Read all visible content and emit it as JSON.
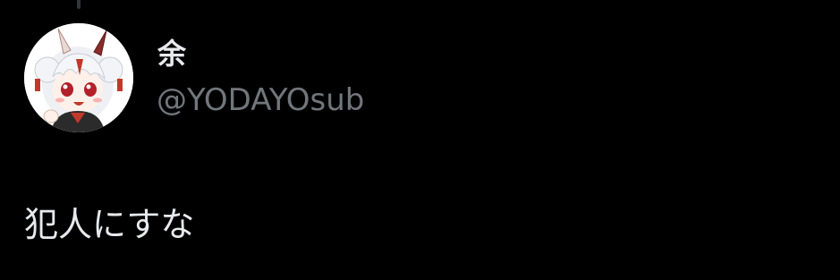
{
  "tweet": {
    "author": {
      "display_name": "余",
      "handle": "@YODAYOsub",
      "avatar_icon": "avatar-image"
    },
    "text": "犯人にすな"
  },
  "colors": {
    "background": "#000000",
    "primary_text": "#e7e9ea",
    "secondary_text": "#71767b",
    "thread_line": "#333639"
  }
}
